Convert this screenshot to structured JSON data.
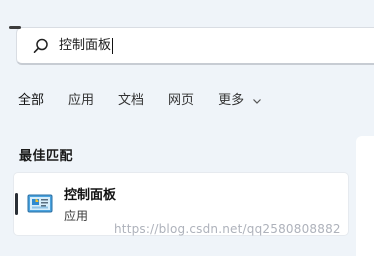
{
  "search": {
    "query": "控制面板"
  },
  "tabs": [
    {
      "label": "全部",
      "active": true
    },
    {
      "label": "应用",
      "active": false
    },
    {
      "label": "文档",
      "active": false
    },
    {
      "label": "网页",
      "active": false
    },
    {
      "label": "更多",
      "active": false
    }
  ],
  "section": {
    "title": "最佳匹配"
  },
  "best_match": {
    "title": "控制面板",
    "subtitle": "应用",
    "icon": "control-panel-icon"
  },
  "watermark": "https://blog.csdn.net/qq2580808882",
  "colors": {
    "background": "#eff4f9",
    "card": "#ffffff",
    "accent_bar": "#2a2f36"
  }
}
